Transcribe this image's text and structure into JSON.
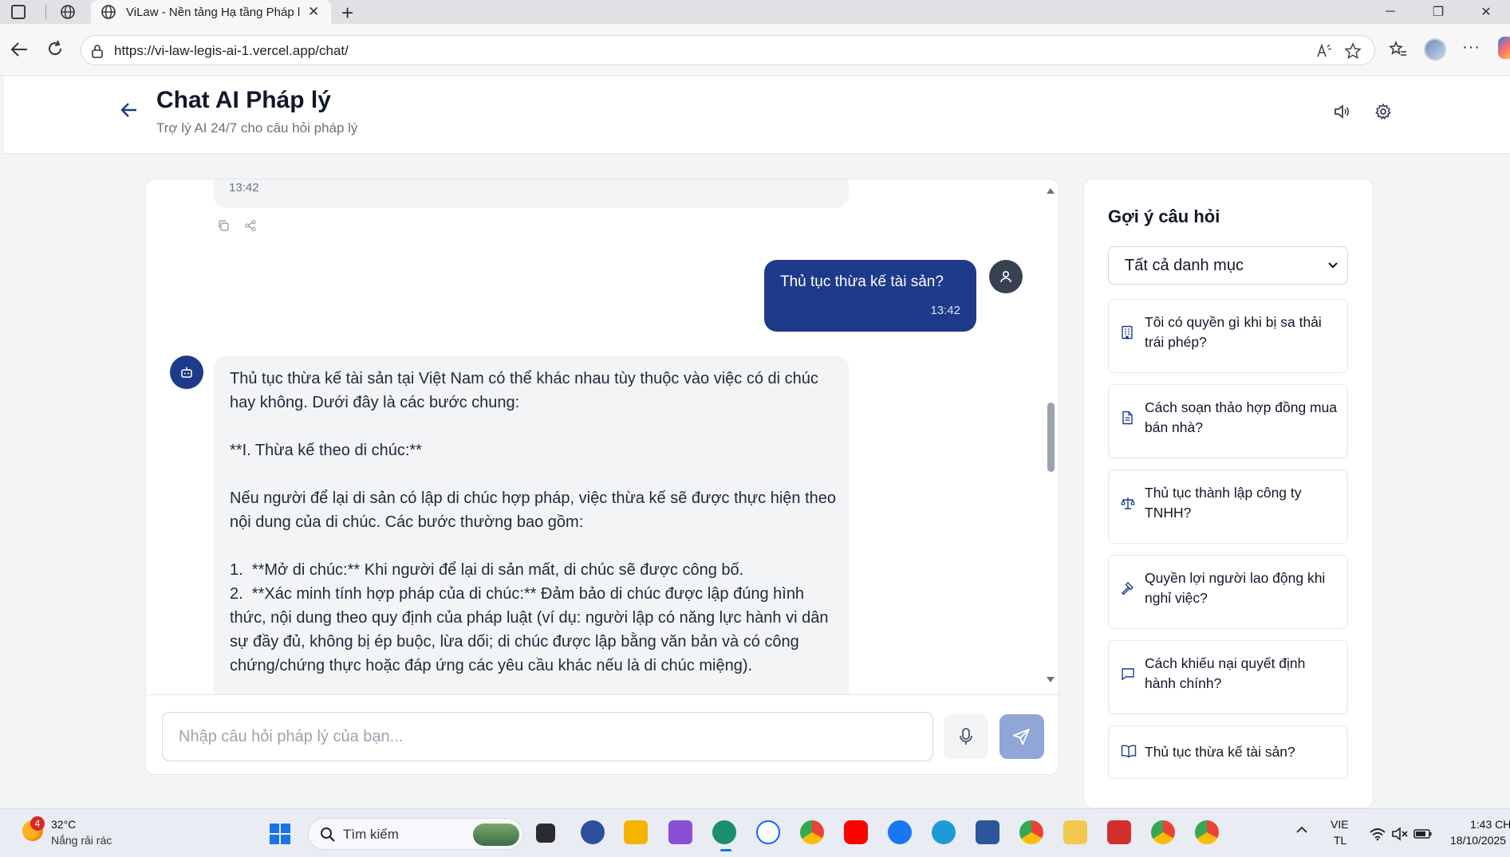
{
  "browser": {
    "tab_title": "ViLaw - Nền tảng Hạ tầng Pháp lý",
    "url": "https://vi-law-legis-ai-1.vercel.app/chat/"
  },
  "header": {
    "title": "Chat AI Pháp lý",
    "subtitle": "Trợ lý AI 24/7 cho câu hỏi pháp lý"
  },
  "chat": {
    "previous_time": "13:42",
    "user_message": {
      "text": "Thủ tục thừa kế tài sản?",
      "time": "13:42"
    },
    "bot_message": {
      "text": "Thủ tục thừa kế tài sản tại Việt Nam có thể khác nhau tùy thuộc vào việc có di chúc hay không. Dưới đây là các bước chung:\n\n**I. Thừa kế theo di chúc:**\n\nNếu người để lại di sản có lập di chúc hợp pháp, việc thừa kế sẽ được thực hiện theo nội dung của di chúc. Các bước thường bao gồm:\n\n1.  **Mở di chúc:** Khi người để lại di sản mất, di chúc sẽ được công bố.\n2.  **Xác minh tính hợp pháp của di chúc:** Đảm bảo di chúc được lập đúng hình thức, nội dung theo quy định của pháp luật (ví dụ: người lập có năng lực hành vi dân sự đầy đủ, không bị ép buộc, lừa dối; di chúc được lập bằng văn bản và có công chứng/chứng thực hoặc đáp ứng các yêu cầu khác nếu là di chúc miệng)."
    },
    "input_placeholder": "Nhập câu hỏi pháp lý của bạn..."
  },
  "sidebar": {
    "title": "Gợi ý câu hỏi",
    "category_selected": "Tất cả danh mục",
    "suggestions": [
      {
        "text": "Tôi có quyền gì khi bị sa thải trái phép?",
        "icon": "building-icon"
      },
      {
        "text": "Cách soạn thảo hợp đồng mua bán nhà?",
        "icon": "document-icon"
      },
      {
        "text": "Thủ tục thành lập công ty TNHH?",
        "icon": "scale-icon"
      },
      {
        "text": "Quyền lợi người lao động khi nghỉ việc?",
        "icon": "gavel-icon"
      },
      {
        "text": "Cách khiếu nại quyết định hành chính?",
        "icon": "message-icon"
      },
      {
        "text": "Thủ tục thừa kế tài sản?",
        "icon": "book-icon"
      }
    ]
  },
  "taskbar": {
    "weather_badge": "4",
    "weather_temp": "32°C",
    "weather_desc": "Nắng rải rác",
    "search_label": "Tìm kiếm",
    "lang_line1": "VIE",
    "lang_line2": "TL",
    "time": "1:43 CH",
    "date": "18/10/2025"
  },
  "colors": {
    "primary": "#1e3a8a",
    "send_disabled": "#8fa6d6",
    "bubble_bg": "#f3f4f6"
  }
}
